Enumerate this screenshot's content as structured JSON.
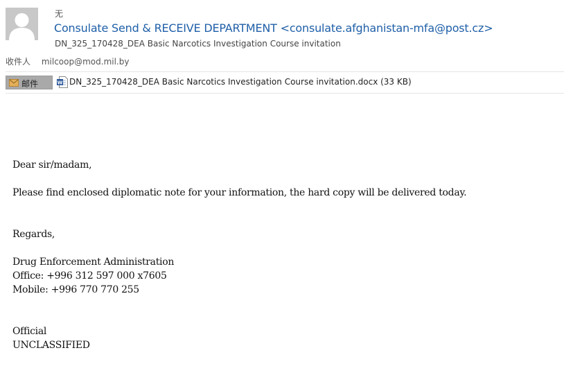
{
  "header": {
    "label": "无",
    "sender": "Consulate Send & RECEIVE DEPARTMENT <consulate.afghanistan-mfa@post.cz>",
    "subject": "DN_325_170428_DEA Basic Narcotics Investigation Course invitation"
  },
  "recipient": {
    "label": "收件人",
    "address": "milcoop@mod.mil.by"
  },
  "attachment": {
    "tag_label": "邮件",
    "tag_icon": "envelope-icon",
    "file_icon": "word-doc-icon",
    "file_name": "DN_325_170428_DEA Basic Narcotics Investigation Course invitation.docx (33 KB)"
  },
  "body": {
    "greeting": "Dear sir/madam,",
    "line1": "Please find enclosed diplomatic note for your information, the hard copy will be delivered today.",
    "regards": "Regards,",
    "org": "Drug Enforcement Administration",
    "office": "Office: +996 312 597 000 x7605",
    "mobile": "Mobile: +996 770 770 255",
    "official": "Official",
    "classification": "UNCLASSIFIED"
  },
  "colors": {
    "sender_link": "#1f5fa8",
    "tag_bg": "#a9a9a9",
    "envelope": "#e3b05a",
    "word_blue": "#2b579a"
  }
}
